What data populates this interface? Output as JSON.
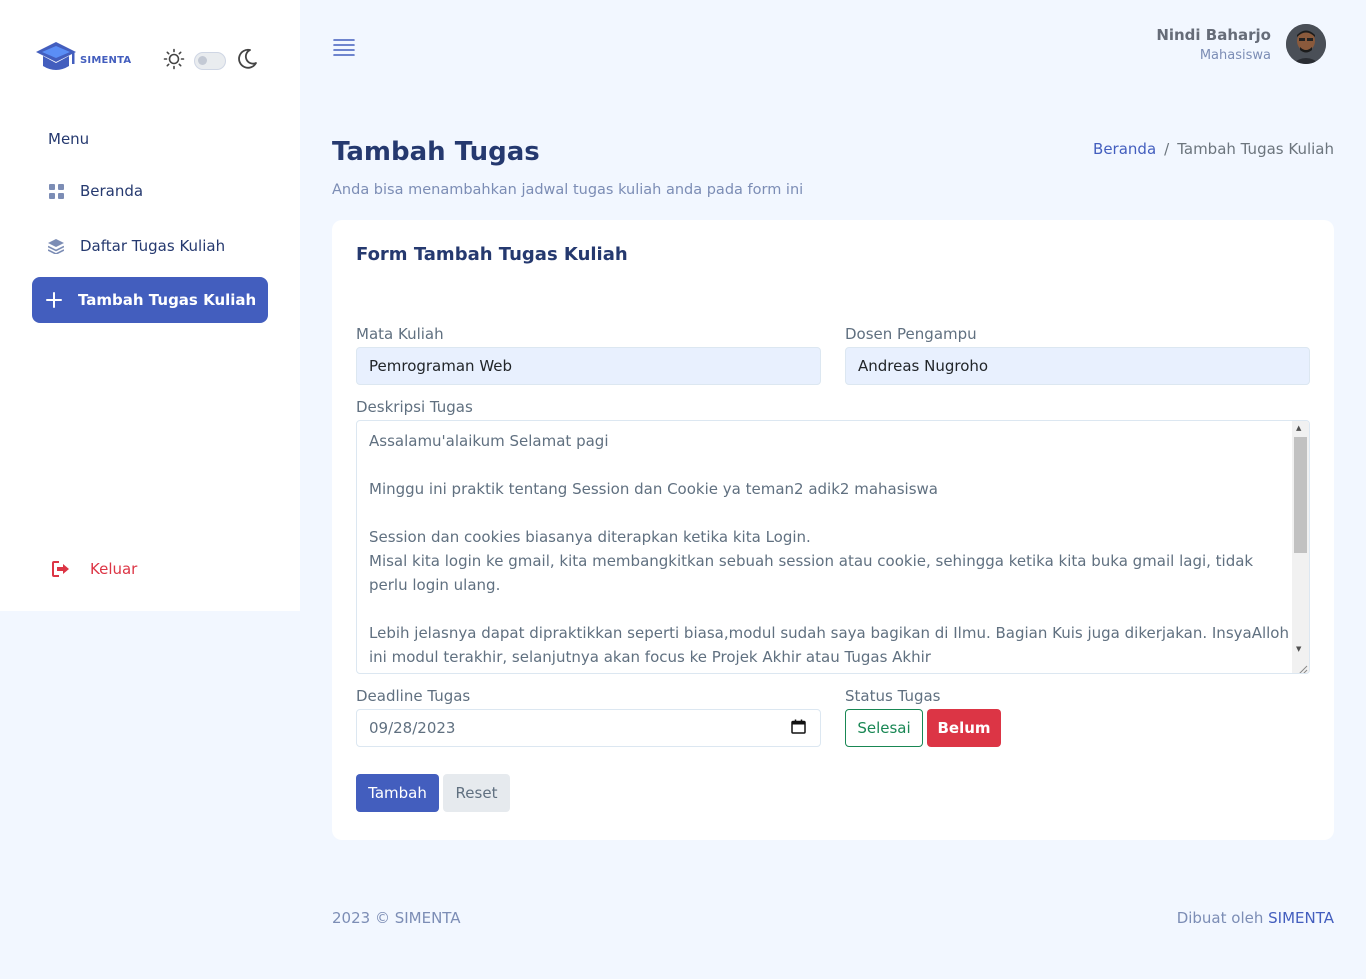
{
  "app": {
    "logo_text": "SIMENTA"
  },
  "sidebar": {
    "menu_title": "Menu",
    "items": [
      {
        "label": "Beranda",
        "icon": "grid-icon"
      },
      {
        "label": "Daftar Tugas Kuliah",
        "icon": "stack-icon"
      },
      {
        "label": "Tambah Tugas Kuliah",
        "icon": "plus-icon",
        "active": true
      }
    ],
    "logout_label": "Keluar"
  },
  "header": {
    "user_name": "Nindi Baharjo",
    "user_role": "Mahasiswa"
  },
  "page": {
    "title": "Tambah Tugas",
    "subtitle": "Anda bisa menambahkan jadwal tugas kuliah anda pada form ini",
    "breadcrumb": {
      "home": "Beranda",
      "current": "Tambah Tugas Kuliah",
      "separator": "/"
    }
  },
  "form": {
    "title": "Form Tambah Tugas Kuliah",
    "mata_kuliah_label": "Mata Kuliah",
    "mata_kuliah_value": "Pemrograman Web",
    "dosen_label": "Dosen Pengampu",
    "dosen_value": "Andreas Nugroho",
    "deskripsi_label": "Deskripsi Tugas",
    "deskripsi_lines": [
      "Assalamu'alaikum Selamat pagi",
      "",
      "Minggu ini praktik tentang Session dan Cookie ya teman2 adik2 mahasiswa",
      "",
      "Session dan cookies biasanya diterapkan ketika kita Login.",
      "Misal kita login ke gmail, kita membangkitkan sebuah session atau cookie, sehingga ketika kita buka gmail lagi, tidak perlu login ulang.",
      "",
      "Lebih jelasnya dapat dipraktikkan seperti biasa,modul sudah saya bagikan di Ilmu. Bagian Kuis juga dikerjakan. InsyaAlloh ini modul terakhir, selanjutnya akan focus ke Projek Akhir atau Tugas Akhir"
    ],
    "deadline_label": "Deadline Tugas",
    "deadline_value": "09/28/2023",
    "status_label": "Status Tugas",
    "status_selesai": "Selesai",
    "status_belum": "Belum",
    "submit_label": "Tambah",
    "reset_label": "Reset"
  },
  "footer": {
    "left": "2023 © SIMENTA",
    "right_prefix": "Dibuat oleh",
    "right_brand": "SIMENTA"
  },
  "colors": {
    "primary": "#435ebe",
    "danger": "#dc3545",
    "success": "#198754",
    "background": "#f2f7ff"
  }
}
